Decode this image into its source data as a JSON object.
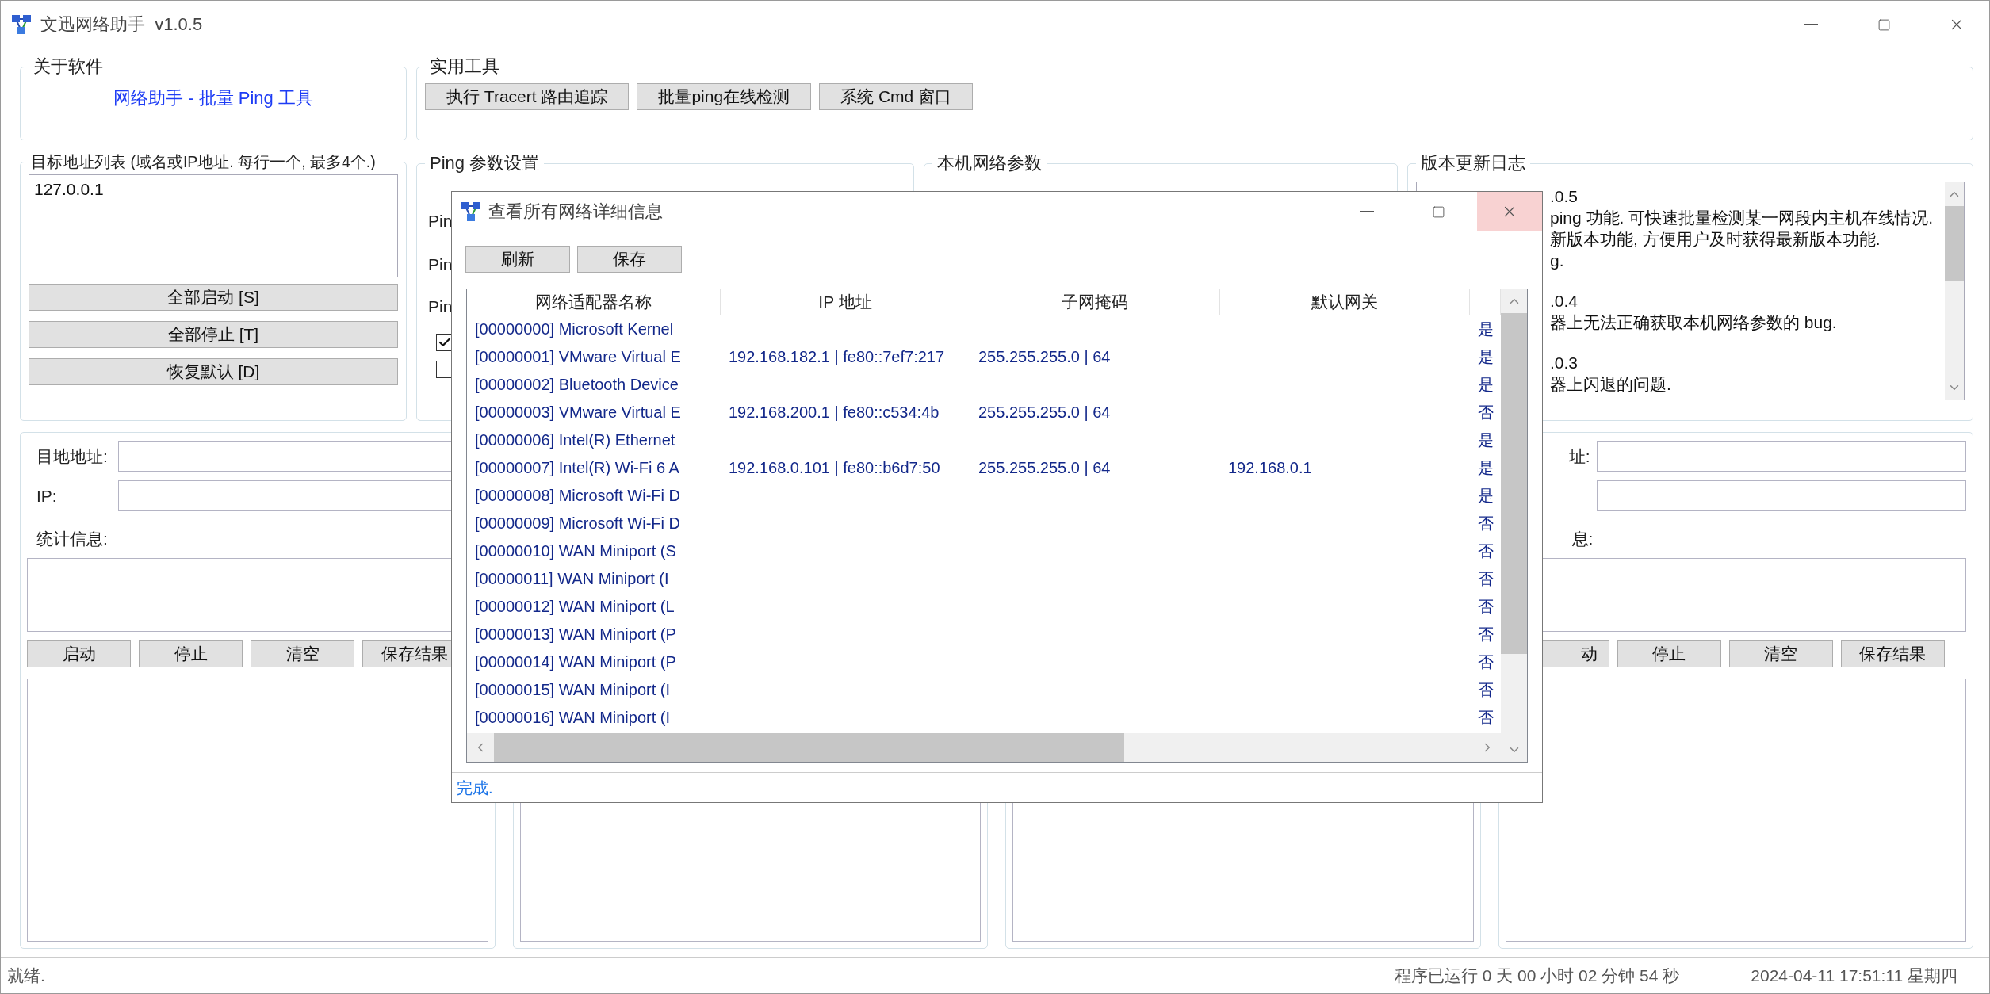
{
  "window": {
    "title": "文迅网络助手  v1.0.5"
  },
  "about": {
    "title": "关于软件",
    "text": "网络助手 - 批量 Ping 工具"
  },
  "tools": {
    "title": "实用工具",
    "buttons": [
      "执行 Tracert 路由追踪",
      "批量ping在线检测",
      "系统 Cmd 窗口"
    ]
  },
  "targets": {
    "title": "目标地址列表 (域名或IP地址. 每行一个, 最多4个.)",
    "value": "127.0.0.1",
    "buttons": [
      "全部启动 [S]",
      "全部停止 [T]",
      "恢复默认 [D]"
    ]
  },
  "ping_settings": {
    "title": "Ping 参数设置",
    "labels": [
      "Pin",
      "Pin",
      "Pin"
    ],
    "checkboxes": [
      {
        "checked": true
      },
      {
        "checked": false
      }
    ]
  },
  "local_network": {
    "title": "本机网络参数"
  },
  "changelog": {
    "title": "版本更新日志",
    "blocks": [
      {
        "lines": [
          ".0.5",
          "ping 功能. 可快速批量检测某一网段内主机在线情况.",
          "新版本功能, 方便用户及时获得最新版本功能.",
          "g."
        ]
      },
      {
        "lines": [
          ".0.4",
          "器上无法正确获取本机网络参数的 bug."
        ]
      },
      {
        "lines": [
          ".0.3",
          "器上闪退的问题."
        ]
      }
    ]
  },
  "ping_panels": [
    {
      "kind": "full",
      "address_label": "目地地址:",
      "ip_label": "IP:",
      "stats_label": "统计信息:",
      "buttons": [
        "启动",
        "停止",
        "清空",
        "保存结果"
      ]
    },
    {
      "kind": "covered"
    },
    {
      "kind": "covered"
    },
    {
      "kind": "partial",
      "address_label": "址:",
      "stats_label": "息:",
      "buttons": [
        "动",
        "停止",
        "清空",
        "保存结果"
      ]
    }
  ],
  "status_bar": {
    "message": "就绪.",
    "uptime": "程序已运行 0 天 00 小时 02 分钟 54 秒",
    "clock": "2024-04-11 17:51:11 星期四"
  },
  "dialog": {
    "title": "查看所有网络详细信息",
    "buttons": [
      "刷新",
      "保存"
    ],
    "columns": [
      "网络适配器名称",
      "IP 地址",
      "子网掩码",
      "默认网关"
    ],
    "rows": [
      {
        "name": "[00000000] Microsoft Kernel",
        "column_5": "是"
      },
      {
        "name": "[00000001] VMware Virtual E",
        "ip": "192.168.182.1 | fe80::7ef7:217",
        "mask": "255.255.255.0 | 64",
        "column_5": "是"
      },
      {
        "name": "[00000002] Bluetooth Device",
        "column_5": "是"
      },
      {
        "name": "[00000003] VMware Virtual E",
        "ip": "192.168.200.1 | fe80::c534:4b",
        "mask": "255.255.255.0 | 64",
        "column_5": "否"
      },
      {
        "name": "[00000006] Intel(R) Ethernet",
        "column_5": "是"
      },
      {
        "name": "[00000007] Intel(R) Wi-Fi 6 A",
        "ip": "192.168.0.101 | fe80::b6d7:50",
        "mask": "255.255.255.0 | 64",
        "gateway": "192.168.0.1",
        "column_5": "是"
      },
      {
        "name": "[00000008] Microsoft Wi-Fi D",
        "column_5": "是"
      },
      {
        "name": "[00000009] Microsoft Wi-Fi D",
        "column_5": "否"
      },
      {
        "name": "[00000010] WAN Miniport (S",
        "column_5": "否"
      },
      {
        "name": "[00000011] WAN Miniport (I",
        "column_5": "否"
      },
      {
        "name": "[00000012] WAN Miniport (L",
        "column_5": "否"
      },
      {
        "name": "[00000013] WAN Miniport (P",
        "column_5": "否"
      },
      {
        "name": "[00000014] WAN Miniport (P",
        "column_5": "否"
      },
      {
        "name": "[00000015] WAN Miniport (I",
        "column_5": "否"
      },
      {
        "name": "[00000016] WAN Miniport (I",
        "column_5": "否"
      }
    ],
    "status": "完成."
  }
}
